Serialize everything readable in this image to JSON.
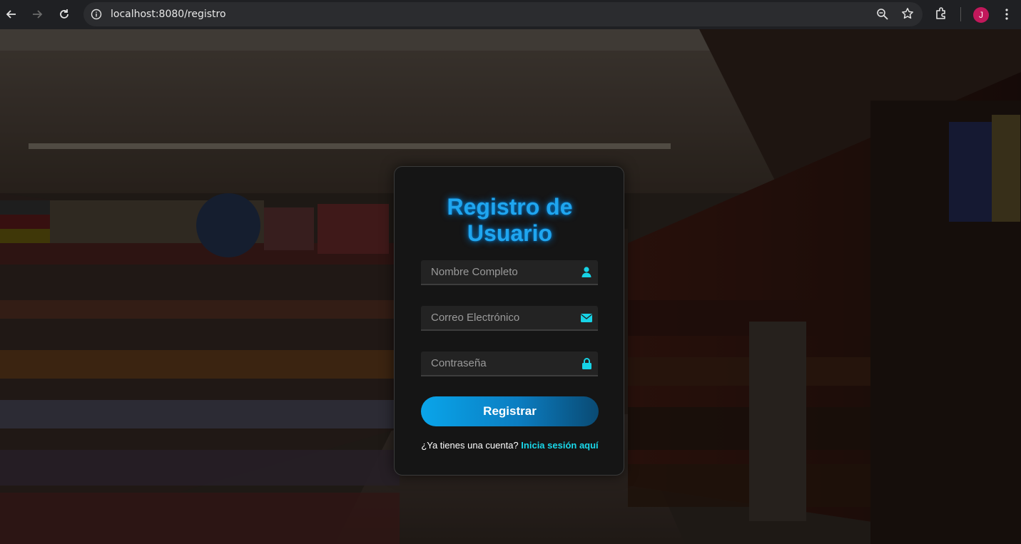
{
  "browser": {
    "url": "localhost:8080/registro",
    "profile_initial": "J",
    "icons": [
      "back-icon",
      "forward-icon",
      "reload-icon",
      "info-icon",
      "zoom-icon",
      "star-icon",
      "extensions-icon",
      "menu-icon"
    ]
  },
  "form": {
    "title_line1": "Registro de",
    "title_line2": "Usuario",
    "name_placeholder": "Nombre Completo",
    "email_placeholder": "Correo Electrónico",
    "password_placeholder": "Contraseña",
    "submit_label": "Registrar",
    "login_prompt": "¿Ya tienes una cuenta?",
    "login_link": "Inicia sesión aquí"
  },
  "colors": {
    "accent": "#1fa6f0",
    "link": "#19d8ea",
    "card_bg": "#151515"
  }
}
